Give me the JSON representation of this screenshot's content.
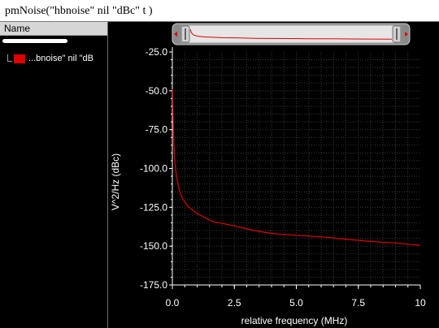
{
  "window": {
    "title": "pmNoise(\"hbnoise\" nil \"dBc\" t )"
  },
  "sidebar": {
    "header": "Name",
    "trace_label": "...bnoise\" nil \"dB"
  },
  "colors": {
    "trace": "#e00000",
    "background": "#000000",
    "axis": "#ffffff",
    "grid": "#3a3a3a"
  },
  "chart_data": {
    "type": "line",
    "xlabel": "relative frequency (MHz)",
    "ylabel": "V^2/Hz (dBc)",
    "xlim": [
      0,
      10
    ],
    "ylim": [
      -175,
      -25
    ],
    "xticks": [
      "0.0",
      "2.5",
      "5.0",
      "7.5",
      "10"
    ],
    "xtick_values": [
      0,
      2.5,
      5,
      7.5,
      10
    ],
    "yticks": [
      "-25.0",
      "-50.0",
      "-75.0",
      "-100.0",
      "-125.0",
      "-150.0",
      "-175.0"
    ],
    "ytick_values": [
      -25,
      -50,
      -75,
      -100,
      -125,
      -150,
      -175
    ],
    "grid": true,
    "series": [
      {
        "color": "#e00000",
        "x": [
          0.01,
          0.03,
          0.06,
          0.1,
          0.15,
          0.2,
          0.3,
          0.4,
          0.6,
          1.0,
          1.6,
          2.5,
          3.3,
          4.1,
          5.0,
          6.0,
          7.0,
          8.0,
          9.0,
          10.0
        ],
        "y": [
          -49,
          -66,
          -83,
          -95,
          -103,
          -108,
          -115,
          -119,
          -124,
          -129,
          -134,
          -137,
          -140,
          -142,
          -143,
          -144,
          -145.5,
          -147,
          -148,
          -149.5
        ]
      }
    ]
  }
}
